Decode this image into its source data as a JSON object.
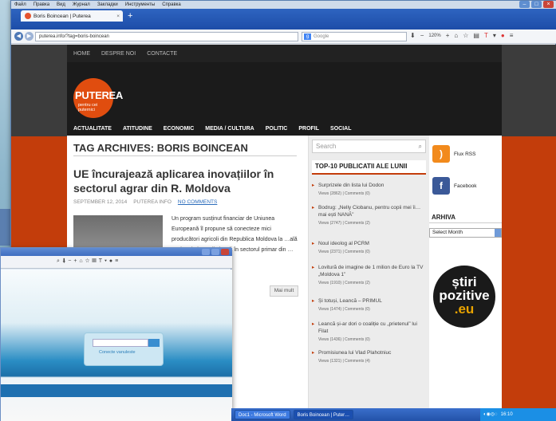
{
  "browser": {
    "menu": [
      "Файл",
      "Правка",
      "Вид",
      "Журнал",
      "Закладки",
      "Инструменты",
      "Справка"
    ],
    "tab_title": "Boris Boincean | Puterea",
    "url": "puterea.info/?tag=boris-boincean",
    "search_placeholder": "Google",
    "zoom": "120%"
  },
  "site": {
    "topnav": [
      "HOME",
      "DESPRE NOI",
      "CONTACTE"
    ],
    "logo_title": "PUTEREA",
    "logo_tagline": "pentru cei puternici",
    "mainnav": [
      "ACTUALITATE",
      "ATITUDINE",
      "ECONOMIC",
      "MEDIA / CULTURA",
      "POLITIC",
      "PROFIL",
      "SOCIAL"
    ],
    "archive_title": "TAG ARCHIVES: BORIS BOINCEAN",
    "post": {
      "title": "UE încurajează aplicarea inovațiilor în sectorul agrar din R. Moldova",
      "date": "SEPTEMBER 12, 2014",
      "author": "PUTEREA INFO",
      "comments": "NO COMMENTS",
      "excerpt": "Un program susținut financiar de Uniunea Europeană îl propune să conecteze mici producători agricoli din Republica Moldova la …ală ce ține de inovații și …ră în sectorul primar din …tel.",
      "more": "Mai mult"
    },
    "sidebar": {
      "search_placeholder": "Search",
      "top_title": "TOP-10 PUBLICATII ALE LUNII",
      "items": [
        {
          "title": "Surprizele din lista lui Dodon",
          "views": "Views (2862) | Comments (0)"
        },
        {
          "title": "Bodrug: „Nelly Ciobanu, pentru copii mei îi… mai ești NANĂ”",
          "views": "Views (2747) | Comments (2)"
        },
        {
          "title": "Noul ideolog al PCRM",
          "views": "Views (2371) | Comments (0)"
        },
        {
          "title": "Lovitură de imagine de 1 milion de Euro la TV „Moldova 1”",
          "views": "Views (1910) | Comments (2)"
        },
        {
          "title": "Și totuși, Leancă – PRIMUL",
          "views": "Views (1474) | Comments (0)"
        },
        {
          "title": "Leancă și-ar dori o coaliție cu „prietenul” lui Filat",
          "views": "Views (1436) | Comments (0)"
        },
        {
          "title": "Promisiunea lui Vlad Plahotniuc",
          "views": "Views (1321) | Comments (4)"
        }
      ],
      "rss": "Flux RSS",
      "facebook": "Facebook",
      "archive_title": "ARHIVA",
      "archive_select": "Select Month",
      "badge_line1": "știri",
      "badge_line2": "pozitive",
      "badge_line3": ".eu"
    }
  },
  "window2": {
    "link": "Conecte vanuleste"
  },
  "taskbar": {
    "items": [
      "Doc1 - Microsoft Word",
      "Boris Boincean | Puter…"
    ],
    "clock": "16:10"
  },
  "colors": {
    "accent": "#c33d0b",
    "site_dark": "#222222",
    "taskbar": "#2352a8"
  }
}
